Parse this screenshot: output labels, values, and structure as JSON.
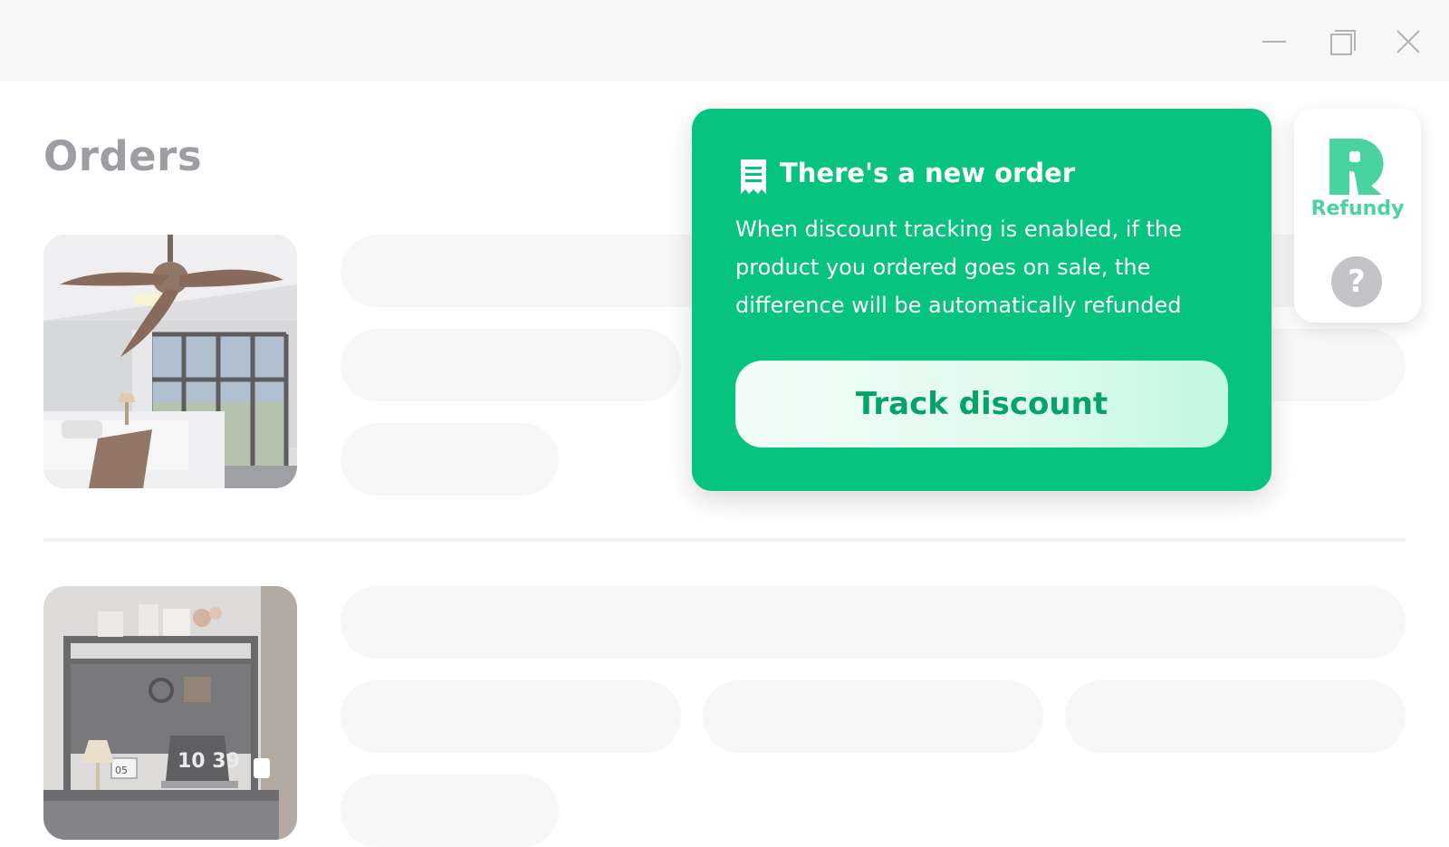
{
  "window": {
    "controls": {
      "minimize_icon": "minimize-icon",
      "maximize_icon": "maximize-icon",
      "close_icon": "close-icon"
    }
  },
  "page": {
    "title": "Orders"
  },
  "orders": [
    {
      "image": "ceiling-fan-bedroom-photo"
    },
    {
      "image": "desk-shelf-photo"
    }
  ],
  "notification": {
    "icon": "receipt-icon",
    "title": "There's a new order",
    "body": "When discount tracking is enabled, if the product you ordered goes on sale, the difference will be automatically refunded",
    "button_label": "Track discount",
    "color": "#06c37f"
  },
  "extension": {
    "logo": "refundy-logo",
    "name": "Refundy",
    "help_label": "?",
    "accent_color": "#4bd39f"
  }
}
